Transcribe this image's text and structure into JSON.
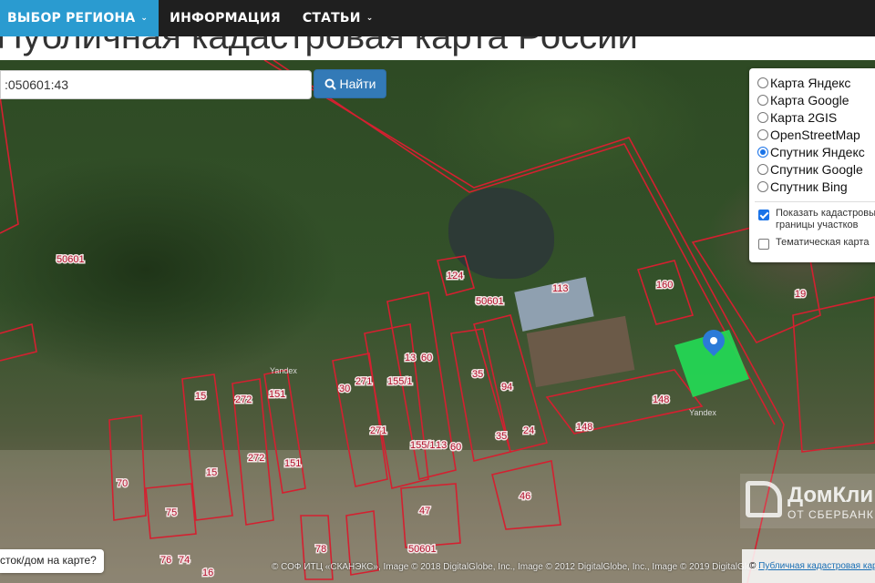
{
  "nav": {
    "items": [
      {
        "label": "ВЫБОР РЕГИОНА",
        "dropdown": true,
        "active": true
      },
      {
        "label": "ИНФОРМАЦИЯ"
      },
      {
        "label": "СТАТЬИ",
        "dropdown": true
      }
    ],
    "accent": "#2a9bd0"
  },
  "title": "Публичная кадастровая карта России",
  "search": {
    "value": ":050601:43",
    "button": "Найти",
    "icon": "search-icon"
  },
  "layers": {
    "options": [
      "Карта Яндекс",
      "Карта Google",
      "Карта 2GIS",
      "OpenStreetMap",
      "Спутник Яндекс",
      "Спутник Google",
      "Спутник Bing"
    ],
    "selected": "Спутник Яндекс",
    "checkboxes": [
      {
        "label": "Показать кадастровые границы участков",
        "checked": true
      },
      {
        "label": "Тематическая карта",
        "checked": false
      }
    ]
  },
  "map": {
    "labels": [
      "50601",
      "50601",
      "50601",
      "15",
      "272",
      "151",
      "30",
      "271",
      "155/1",
      "13",
      "60",
      "35",
      "94",
      "24",
      "148",
      "148",
      "160",
      "113",
      "124",
      "19",
      "70",
      "75",
      "46",
      "47",
      "15",
      "272",
      "151",
      "271",
      "155/1",
      "13",
      "60",
      "35",
      "76",
      "74",
      "16",
      "78",
      "Yandex",
      "Yandex"
    ],
    "selected_parcel_color": "#22dd55",
    "parcel_border_color": "#d42030"
  },
  "hint": "сток/дом на карте?",
  "attribution": "© СОФ ИТЦ «СКАНЭКС», Image © 2018 DigitalGlobe, Inc., Image © 2012 DigitalGlobe, Inc., Image © 2019 DigitalGlobe, Inc.",
  "attribution_link": "Публичная кадастровая карта",
  "logo": {
    "line1": "ДомКлик",
    "line2": "ОТ СБЕРБАНКА"
  }
}
